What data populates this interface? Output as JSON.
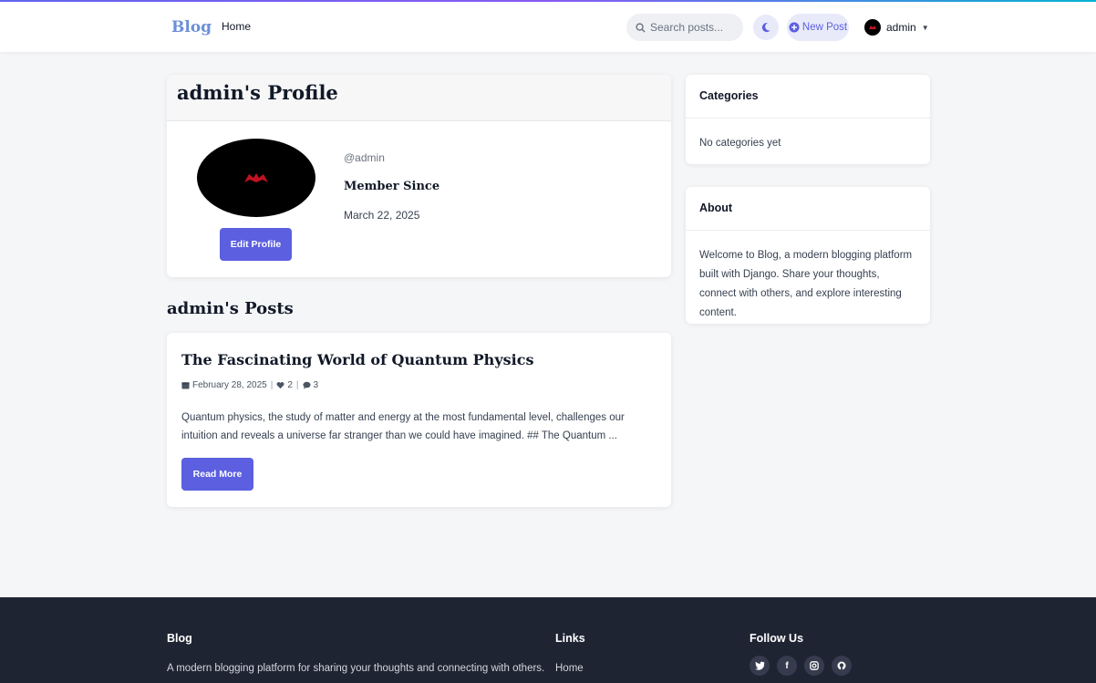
{
  "header": {
    "brand": "Blog",
    "nav_home": "Home",
    "search_placeholder": "Search posts...",
    "new_post_label": "New Post",
    "user_name": "admin"
  },
  "profile": {
    "title": "admin's Profile",
    "username": "@admin",
    "member_since_label": "Member Since",
    "member_since_date": "March 22, 2025",
    "edit_button": "Edit Profile"
  },
  "posts": {
    "heading": "admin's Posts",
    "items": [
      {
        "title": "The Fascinating World of Quantum Physics",
        "date": "February 28, 2025",
        "likes": "2",
        "comments": "3",
        "excerpt": "Quantum physics, the study of matter and energy at the most fundamental level, challenges our intuition and reveals a universe far stranger than we could have imagined. ## The Quantum ...",
        "read_more": "Read More"
      }
    ]
  },
  "sidebar": {
    "categories": {
      "title": "Categories",
      "empty_text": "No categories yet"
    },
    "about": {
      "title": "About",
      "text": "Welcome to Blog, a modern blogging platform built with Django. Share your thoughts, connect with others, and explore interesting content."
    }
  },
  "footer": {
    "brand_title": "Blog",
    "brand_text": "A modern blogging platform for sharing your thoughts and connecting with others.",
    "links_title": "Links",
    "links": [
      "Home"
    ],
    "follow_title": "Follow Us",
    "social_icons": [
      "twitter-icon",
      "facebook-icon",
      "instagram-icon",
      "github-icon"
    ]
  },
  "colors": {
    "accent": "#5b5fe0",
    "brand": "#6c8fd9",
    "footer_bg": "#1f2433"
  }
}
